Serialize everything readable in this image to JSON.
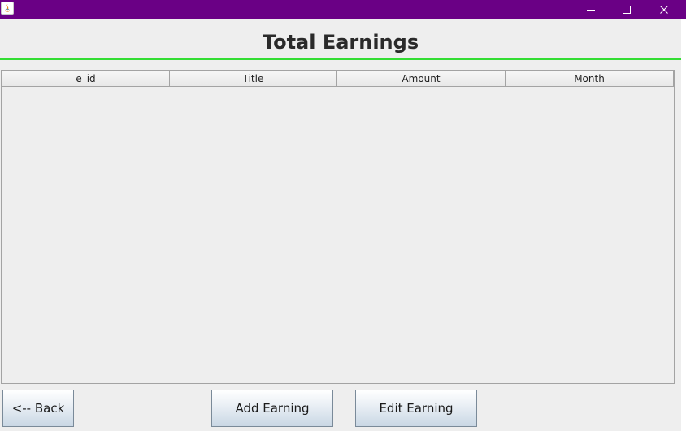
{
  "window": {
    "title": "",
    "titlebar_color": "#6a0085",
    "controls": {
      "minimize_icon": "minimize-icon",
      "maximize_icon": "maximize-icon",
      "close_icon": "close-icon"
    }
  },
  "header": {
    "title": "Total Earnings",
    "rule_color": "#33dd33"
  },
  "table": {
    "columns": [
      "e_id",
      "Title",
      "Amount",
      "Month"
    ],
    "rows": []
  },
  "buttons": {
    "back": "<-- Back",
    "add": "Add Earning",
    "edit": "Edit Earning"
  }
}
